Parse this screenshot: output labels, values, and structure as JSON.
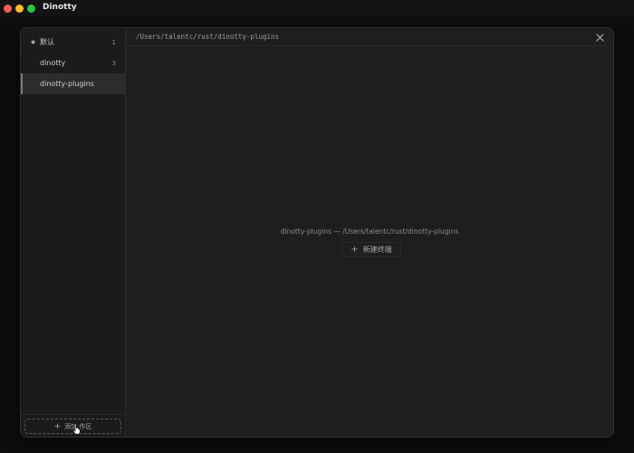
{
  "app": {
    "title": "Dinotty"
  },
  "sidebar": {
    "items": [
      {
        "icon": "star-icon",
        "label": "默认",
        "count": "1"
      },
      {
        "label": "dinotty",
        "count": "3"
      },
      {
        "label": "dinotty-plugins",
        "count": ""
      }
    ],
    "add_workspace_label": "添加工作区",
    "add_workspace_visible": "添加  作区"
  },
  "main": {
    "path": "/Users/talentc/rust/dinotty-plugins",
    "empty_caption": "dinotty-plugins — /Users/talentc/rust/dinotty-plugins",
    "new_terminal_label": "新建终端"
  },
  "colors": {
    "close": "#ff5f57",
    "minimize": "#febc2e",
    "zoom": "#28c840",
    "panel_bg": "#1e1e1e",
    "sidebar_bg": "#1b1b1b"
  }
}
